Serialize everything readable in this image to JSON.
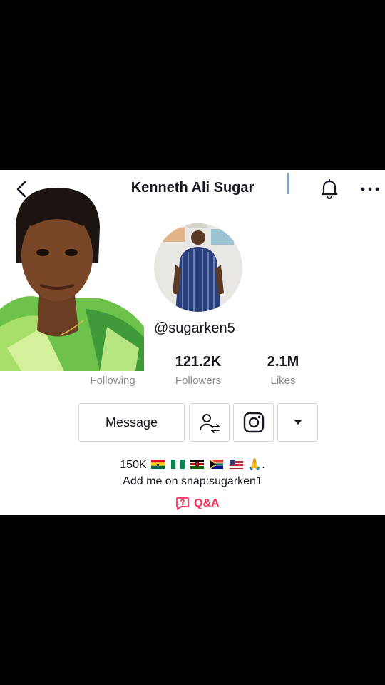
{
  "header": {
    "title": "Kenneth Ali Sugar"
  },
  "profile": {
    "username": "@sugarken5"
  },
  "stats": [
    {
      "value": "",
      "label": "Following"
    },
    {
      "value": "121.2K",
      "label": "Followers"
    },
    {
      "value": "2.1M",
      "label": "Likes"
    }
  ],
  "actions": {
    "message_label": "Message"
  },
  "bio": {
    "line1_prefix": "150K",
    "line1_suffix": ".",
    "flags": [
      "ghana-flag",
      "nigeria-flag",
      "kenya-flag",
      "south-africa-flag",
      "usa-flag"
    ],
    "emoji": "🙏",
    "line2": "Add me on snap:sugarken1"
  },
  "qa": {
    "label": "Q&A"
  },
  "colors": {
    "accent": "#fe2c55",
    "text": "#161823",
    "muted": "#8a8b91",
    "border": "#d6d6d8"
  },
  "icons": [
    "back-arrow-icon",
    "bell-icon",
    "more-icon",
    "add-friends-icon",
    "instagram-icon",
    "dropdown-arrow-icon",
    "qa-icon"
  ]
}
